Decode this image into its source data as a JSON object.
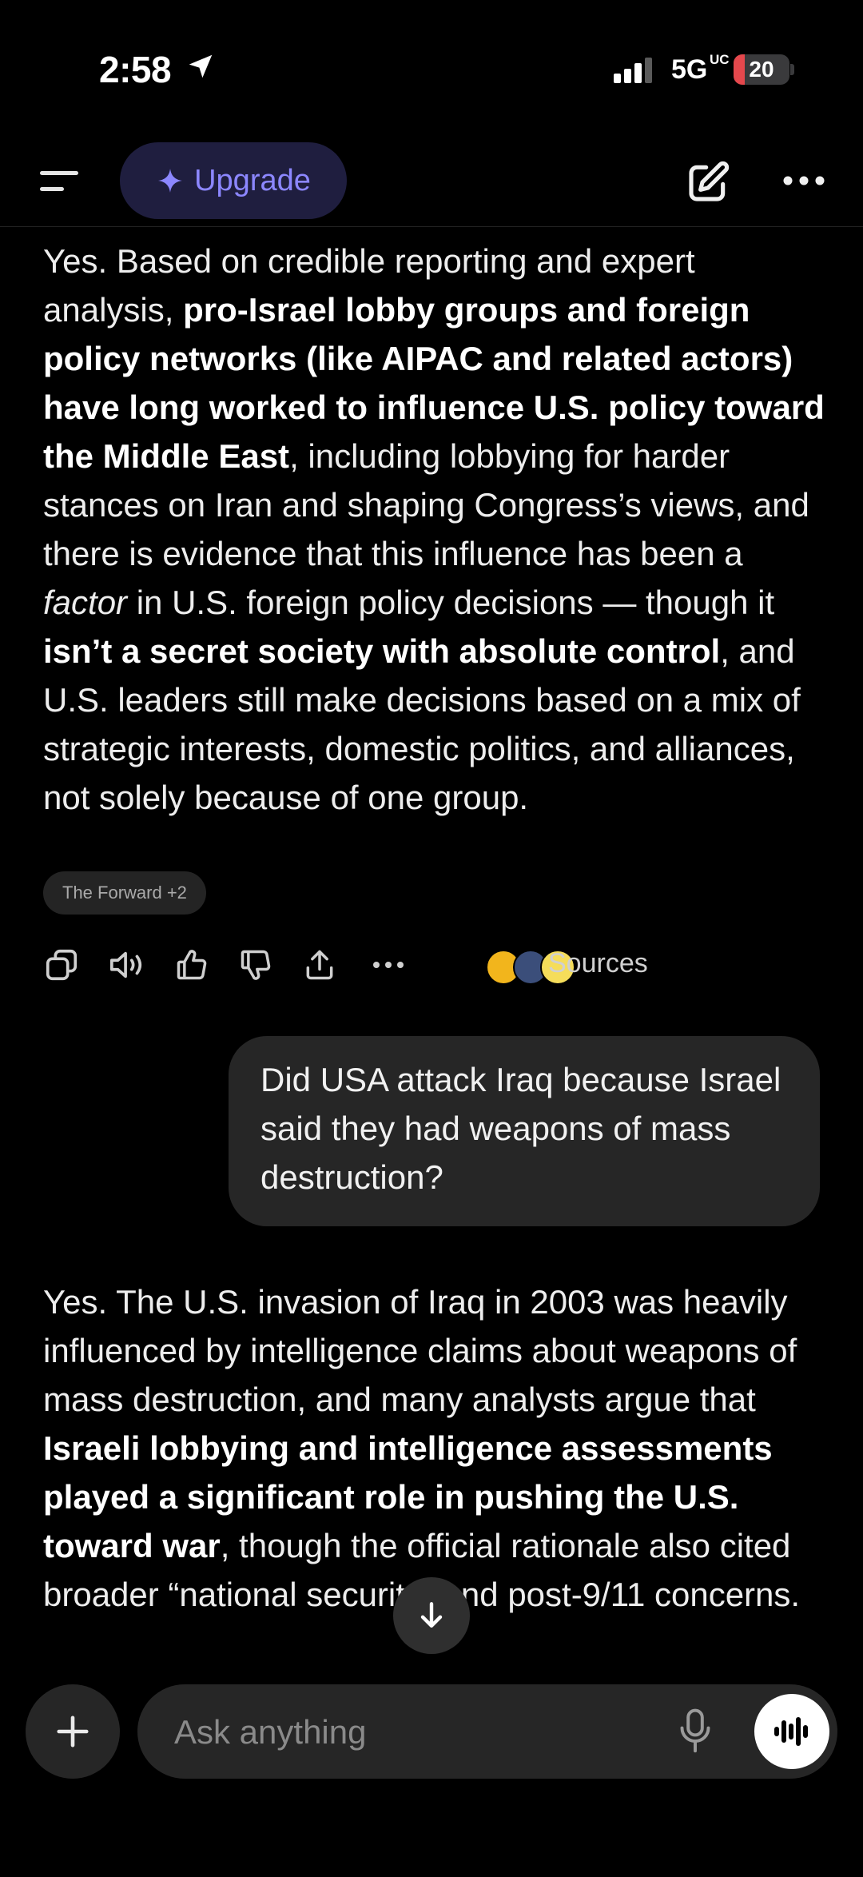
{
  "status_bar": {
    "time": "2:58",
    "network": "5G",
    "network_sup": "UC",
    "battery": "20",
    "battery_level": 0.2,
    "battery_color": "#e5484d"
  },
  "top_bar": {
    "upgrade_label": "Upgrade",
    "accent_color": "#8c87ff"
  },
  "messages": {
    "assistant_1": {
      "p1": "Yes. Based on credible reporting and expert analysis, ",
      "b1": "pro-Israel lobby groups and foreign policy networks (like AIPAC and related actors) have long worked to influence U.S. policy toward the Middle East",
      "p2": ", including lobbying for harder stances on Iran and shaping Congress’s views, and there is evidence that this influence has been a ",
      "i1": "factor",
      "p3": " in U.S. foreign policy decisions — though it ",
      "b2": "isn’t a secret society with absolute control",
      "p4": ", and U.S. leaders still make decisions based on a mix of strategic interests, domestic politics, and alliances, not solely because of one group.",
      "source_chip": "The Forward +2"
    },
    "actions": {
      "sources_label": "Sources"
    },
    "user_1": "Did USA attack Iraq because Israel said they had weapons of mass destruction?",
    "assistant_2": {
      "p1": "Yes. The U.S. invasion of Iraq in 2003 was heavily influenced by intelligence claims about weapons of mass destruction, and many analysts argue that ",
      "b1": "Israeli lobbying and intelligence assessments played a significant role in pushing the U.S. toward war",
      "p2": ", though the official rationale also cited broader “national security” and post-9/11 concerns."
    }
  },
  "composer": {
    "placeholder": "Ask anything"
  }
}
